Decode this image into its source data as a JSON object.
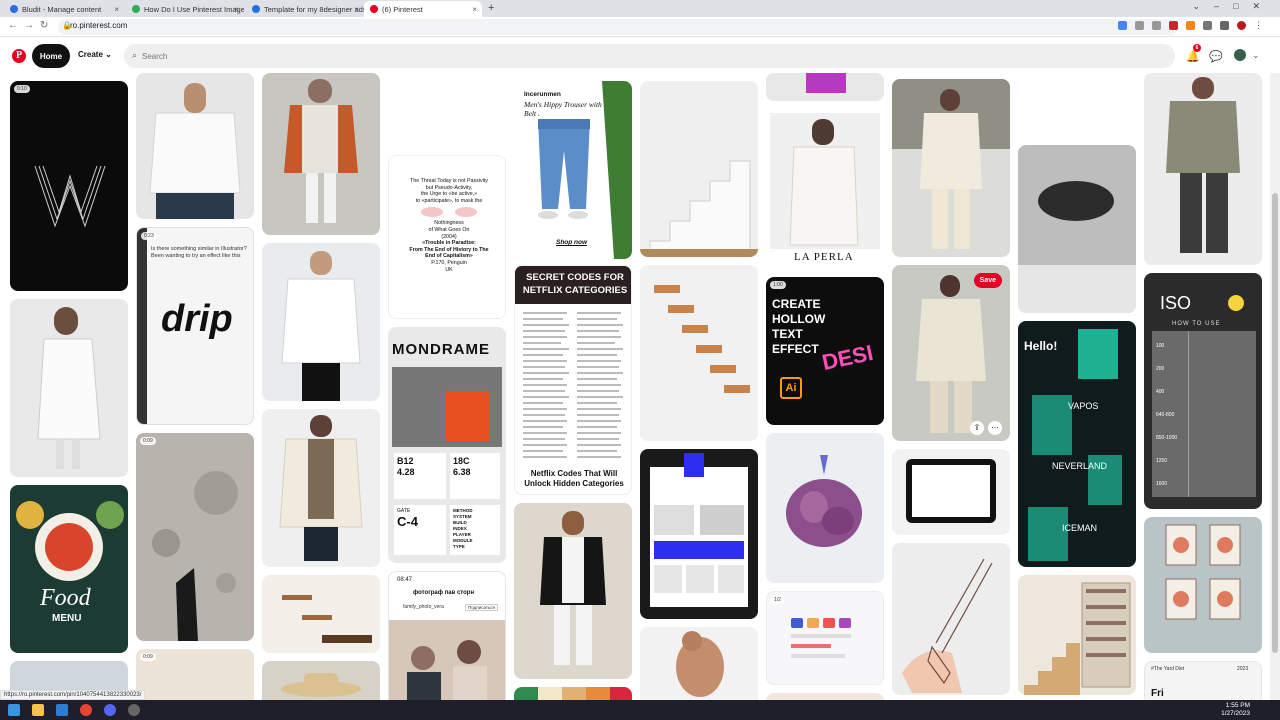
{
  "browser": {
    "tabs": [
      {
        "label": "Bludit - Manage content",
        "color": "#2d6cdf"
      },
      {
        "label": "How Do I Use Pinterest Images",
        "color": "#34a853"
      },
      {
        "label": "Template for my 8designer ads",
        "color": "#1a73e8"
      },
      {
        "label": "(6) Pinterest",
        "color": "#e60023"
      }
    ],
    "new_tab": "+",
    "url": "ro.pinterest.com",
    "status_url": "https://ro.pinterest.com/pin/1040754413822330023/"
  },
  "header": {
    "logo": "P",
    "home": "Home",
    "create": "Create",
    "search_placeholder": "Search",
    "notif_count": "6"
  },
  "pins": {
    "p1_badge": "0:10",
    "p6_badge": "0:23",
    "p6_text": "drip",
    "p6_caption": "Is there something similar in Illustrator? Been wanting to try an effect like this",
    "p7_badge": "0:09",
    "p15_lines": [
      "The Threat Today is not Passivity",
      "but Pseudo-Activity,",
      "the Urge to «be active,»",
      "to «participate», to mask the",
      "Nothingness",
      "of What Goes On",
      "(2004)",
      "«Trouble in Paradise:",
      "From The End of History to The",
      "End of Capitalism»",
      "P.170, Penguin",
      "UK"
    ],
    "p16_title": "MONDRAME",
    "p16_nums": [
      "B12",
      "4.28",
      "18C",
      "6.38",
      "C-4"
    ],
    "p16_words": [
      "METHOD",
      "SYSTEM",
      "BUILD",
      "INDEX",
      "PLAYER",
      "MODULE",
      "TYPE"
    ],
    "p16_gate": "GATE",
    "p17_time": "08:47",
    "p17_title": "фотограф пав сторн",
    "p17_user": "family_photo_vera",
    "p17_follow": "Подписаться",
    "p18_brand": "Incerunmen",
    "p18_title": "Men's Hippy Trouser with Belt .",
    "p18_shop": "Shop now",
    "p19_title": "SECRET CODES FOR NETFLIX CATEGORIES",
    "p19_caption": "Netflix Codes That Will Unlock Hidden Categories",
    "p23_brand": "LA PERLA",
    "p24_badge": "1:00",
    "p24_text": "CREATE HOLLOW TEXT EFFECT",
    "p24_ai": "Ai",
    "p24_word": "DESI",
    "p25_badge": "1/2",
    "p27_save": "Save",
    "p28_badge": "0:09",
    "p30_hello": "Hello!",
    "p30_words": [
      "VAPOS",
      "NEVERLAND",
      "ICEMAN"
    ],
    "p33_title": "ISO",
    "p33_sub": "HOW TO USE",
    "p33_vals": [
      "100",
      "200",
      "400",
      "640-800",
      "850-1000",
      "1250",
      "1600"
    ],
    "p35_caption": "#The Yard Diet",
    "p35_num": "2023",
    "p35_word": "Fri"
  },
  "taskbar": {
    "time": "1:55 PM",
    "date": "1/27/2023"
  }
}
